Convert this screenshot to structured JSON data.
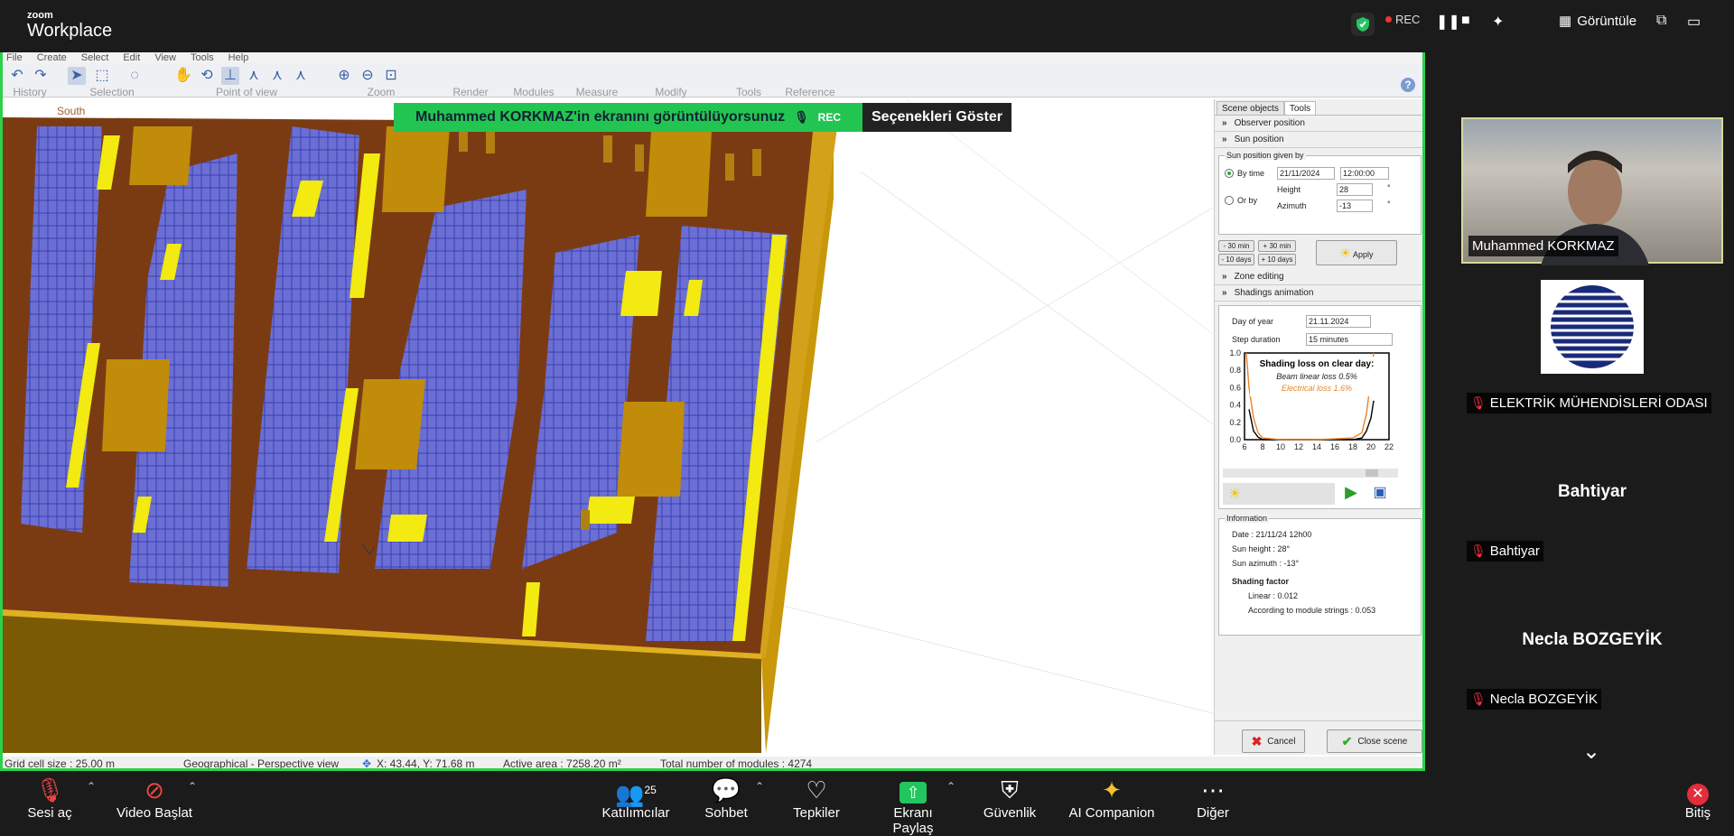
{
  "zoom": {
    "logo_small": "zoom",
    "logo_big": "Workplace",
    "rec_label": "REC",
    "view_label": "Görüntüle"
  },
  "share_banner": {
    "text": "Muhammed KORKMAZ'in ekranını görüntülüyorsunuz",
    "rec": "REC",
    "options": "Seçenekleri Göster"
  },
  "app": {
    "menu": [
      "File",
      "Create",
      "Select",
      "Edit",
      "View",
      "Tools",
      "Help"
    ],
    "toolbar_groups": [
      "History",
      "Selection",
      "Point of view",
      "Zoom",
      "Render",
      "Modules",
      "Measure",
      "Modify",
      "Tools",
      "Reference"
    ],
    "viewport_label": "South",
    "panel": {
      "tabs": [
        "Scene objects",
        "Tools"
      ],
      "sections": {
        "observer": "Observer position",
        "sun": "Sun position",
        "zone": "Zone editing",
        "shadings": "Shadings animation"
      },
      "sun_box_legend": "Sun position given by",
      "by_time": "By time",
      "date": "21/11/2024",
      "time": "12:00:00",
      "or_by": "Or by",
      "height_label": "Height",
      "height_value": "28",
      "azimuth_label": "Azimuth",
      "azimuth_value": "-13",
      "deg": "°",
      "btn_minus30": "- 30 min",
      "btn_plus30": "+ 30 min",
      "btn_minus10": "- 10 days",
      "btn_plus10": "+ 10 days",
      "apply": "Apply",
      "day_of_year_label": "Day of year",
      "day_of_year": "21.11.2024",
      "step_label": "Step duration",
      "step": "15 minutes",
      "info_legend": "Information",
      "info_date": "Date : 21/11/24 12h00",
      "info_height": "Sun height : 28°",
      "info_azimuth": "Sun azimuth : -13°",
      "shading_factor": "Shading factor",
      "linear": "Linear : 0.012",
      "strings": "According to module strings : 0.053",
      "cancel": "Cancel",
      "close": "Close scene"
    },
    "status": {
      "grid": "Grid cell size : 25.00 m",
      "view": "Geographical - Perspective view",
      "coords": "X: 43.44, Y: 71.68 m",
      "area": "Active area : 7258.20 m²",
      "modules": "Total number of modules : 4274"
    }
  },
  "chart_data": {
    "type": "line",
    "title": "Shading loss on clear day:",
    "annotations": [
      "Beam linear loss 0.5%",
      "Electrical loss 1.6%"
    ],
    "x_ticks": [
      "6",
      "8",
      "10",
      "12",
      "14",
      "16",
      "18",
      "20",
      "22"
    ],
    "y_ticks": [
      "0.0",
      "0.2",
      "0.4",
      "0.6",
      "0.8",
      "1.0"
    ],
    "xlim": [
      6,
      22
    ],
    "ylim": [
      0,
      1
    ],
    "series": [
      {
        "name": "Beam linear loss 0.5%",
        "color": "#000000",
        "x": [
          6.5,
          7,
          7.5,
          8,
          10,
          14,
          18,
          19,
          19.5,
          20,
          20.3
        ],
        "y": [
          0.35,
          0.1,
          0.03,
          0.0,
          0.0,
          0.0,
          0.0,
          0.02,
          0.1,
          0.25,
          0.45
        ]
      },
      {
        "name": "Electrical loss 1.6%",
        "color": "#e8842a",
        "x": [
          6.2,
          6.5,
          7,
          7.5,
          8,
          10,
          14,
          18,
          19,
          19.5,
          20,
          20.3
        ],
        "y": [
          1.0,
          0.6,
          0.25,
          0.08,
          0.02,
          0.0,
          0.0,
          0.02,
          0.08,
          0.3,
          0.7,
          1.0
        ]
      }
    ]
  },
  "participants": [
    {
      "name": "Muhammed KORKMAZ",
      "video": true
    },
    {
      "name": "ELEKTRİK MÜHENDİSLERİ ODASI",
      "logo": true
    },
    {
      "name": "Bahtiyar",
      "display": "Bahtiyar"
    },
    {
      "name": "Necla BOZGEYİK",
      "display": "Necla BOZGEYİK"
    }
  ],
  "bottom_bar": {
    "mic": "Sesi aç",
    "video": "Video Başlat",
    "participants": "Katılımcılar",
    "participants_count": "25",
    "chat": "Sohbet",
    "reactions": "Tepkiler",
    "share": "Ekranı Paylaş",
    "security": "Güvenlik",
    "ai": "AI Companion",
    "more": "Diğer",
    "end": "Bitiş"
  }
}
